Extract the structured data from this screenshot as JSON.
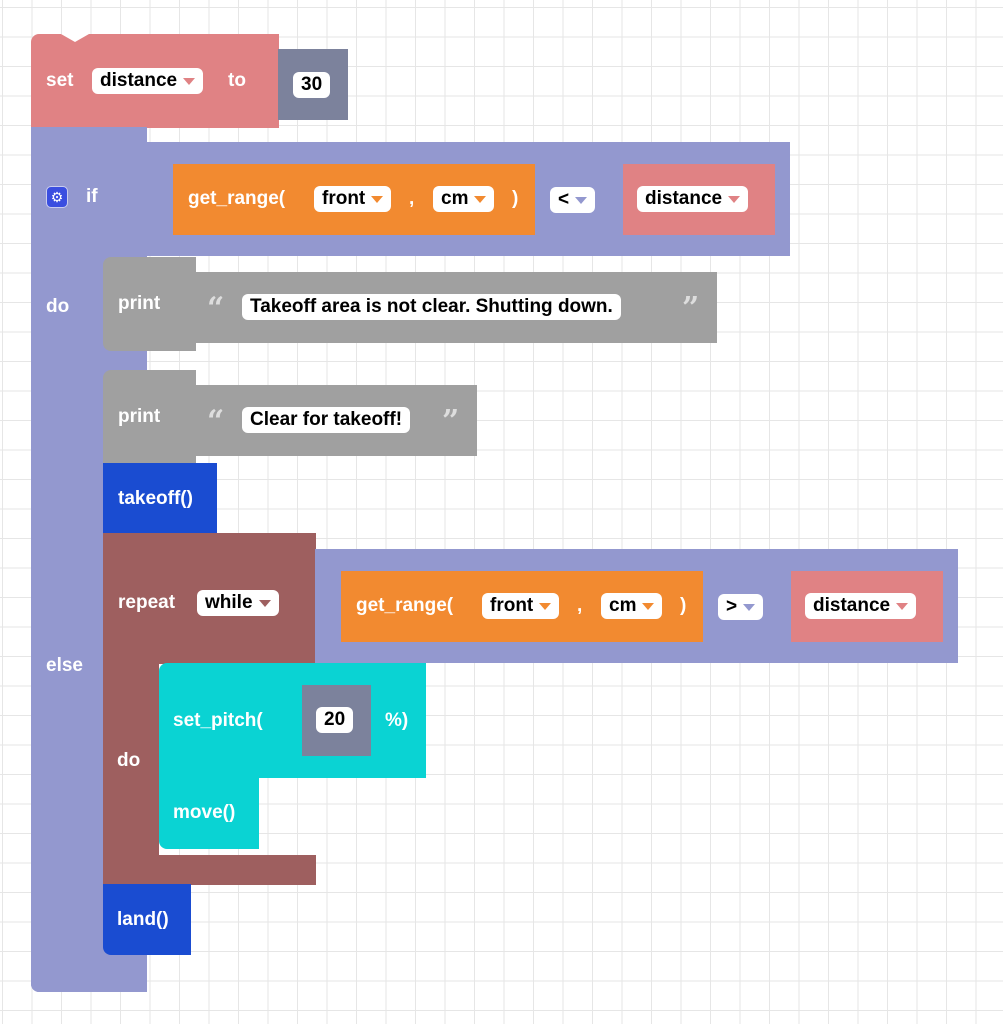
{
  "workspace": {
    "set_block": {
      "keyword": "set",
      "variable": "distance",
      "to_label": "to",
      "value": "30"
    },
    "if_block": {
      "if_label": "if",
      "do_label": "do",
      "else_label": "else",
      "condition": {
        "func": "get_range(",
        "arg1": "front",
        "comma": ",",
        "arg2": "cm",
        "close": ")",
        "operator": "<",
        "rhs": "distance"
      },
      "do_statements": [
        {
          "keyword": "print",
          "text": "Takeoff area is not clear. Shutting down."
        }
      ],
      "else_statements": {
        "print": {
          "keyword": "print",
          "text": "Clear for takeoff!"
        },
        "takeoff": "takeoff()",
        "repeat": {
          "keyword": "repeat",
          "mode": "while",
          "do_label": "do",
          "condition": {
            "func": "get_range(",
            "arg1": "front",
            "comma": ",",
            "arg2": "cm",
            "close": ")",
            "operator": ">",
            "rhs": "distance"
          },
          "body": {
            "set_pitch": {
              "func": "set_pitch(",
              "value": "20",
              "suffix": "%)"
            },
            "move": "move()"
          }
        },
        "land": "land()"
      }
    },
    "quote_open": "“",
    "quote_close": "”"
  },
  "colors": {
    "variable": "#e08284",
    "logic": "#9398cf",
    "number": "#7c829c",
    "sensor": "#f28a30",
    "text": "#a0a0a0",
    "flight": "#1a4cd1",
    "loop": "#9e5f5f",
    "motion": "#0ad3d3"
  }
}
